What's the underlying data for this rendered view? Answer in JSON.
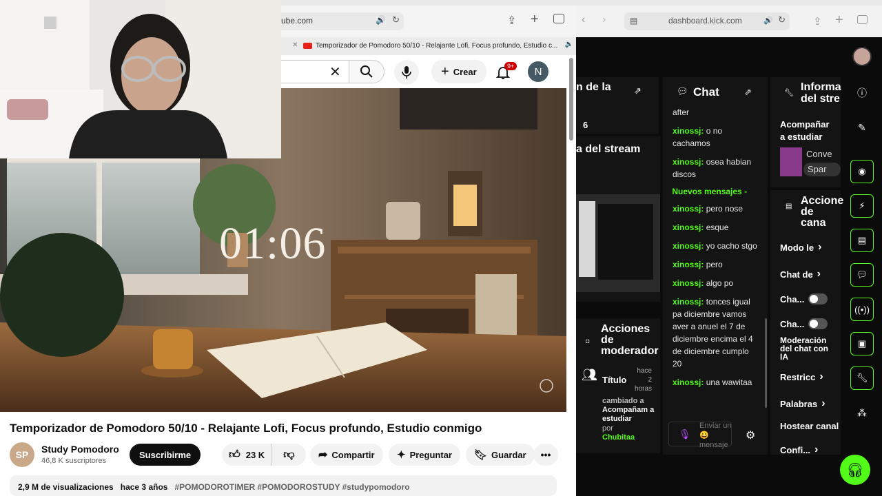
{
  "youtube": {
    "url": "ube.com",
    "tab_title": "Temporizador de Pomodoro 50/10 - Relajante Lofi, Focus profundo, Estudio c...",
    "create_label": "Crear",
    "notif_count": "9+",
    "avatar_letter": "N",
    "timer": "01:06",
    "video_title": "Temporizador de Pomodoro 50/10 - Relajante Lofi, Focus profundo, Estudio conmigo",
    "channel_name": "Study Pomodoro",
    "subscribers": "46,8 K suscriptores",
    "subscribe_label": "Suscribirme",
    "likes": "23 K",
    "share_label": "Compartir",
    "ask_label": "Preguntar",
    "save_label": "Guardar",
    "views": "2,9 M de visualizaciones",
    "age": "hace 3 años",
    "tags": "#POMODOROTIMER #POMODOROSTUDY #studypomodoro"
  },
  "kick": {
    "url": "dashboard.kick.com",
    "panel_left_title": "n de la",
    "panel_left_num": "6",
    "panel_stream_title": "a del stream",
    "chat_title": "Chat",
    "chat_messages": [
      {
        "user": "",
        "text": "after"
      },
      {
        "user": "xinossj",
        "text": "o no cachamos"
      },
      {
        "user": "xinossj",
        "text": "osea habian discos"
      },
      {
        "user": "xinossj",
        "text": "pero nose"
      },
      {
        "user": "xinossj",
        "text": "esque"
      },
      {
        "user": "xinossj",
        "text": "yo cacho stgo"
      },
      {
        "user": "xinossj",
        "text": "pero"
      },
      {
        "user": "xinossj",
        "text": "algo po"
      },
      {
        "user": "xinossj",
        "text": "tonces igual pa diciembre vamos aver a anuel el 7 de diciembre encima el 4 de diciembre cumplo 20"
      },
      {
        "user": "xinossj",
        "text": "una wawitaa"
      }
    ],
    "new_messages_label": "Nuevos mensajes",
    "chat_placeholder": "Enviar un 😀 mensaje",
    "info_title": "Informa del stre",
    "info_category": "Acompañar a estudiar",
    "info_conv": "Conve",
    "info_spar": "Spar",
    "mod_title": "Acciones de moderador",
    "mod_item_title": "Título",
    "mod_item_time": "hace 2 horas",
    "mod_item_desc": "cambiado a",
    "mod_item_value": "Acompañam a estudiar",
    "mod_item_by": "por",
    "mod_item_user": "Chubitaa",
    "channel_actions_title": "Accione de cana",
    "action_modo": "Modo le",
    "action_chat": "Chat de",
    "action_cha1": "Cha...",
    "action_cha2": "Cha...",
    "action_moderacion": "Moderación del chat con IA",
    "action_restric": "Restricc",
    "action_palabras": "Palabras",
    "action_hostear": "Hostear canal",
    "action_confi": "Confi..."
  }
}
